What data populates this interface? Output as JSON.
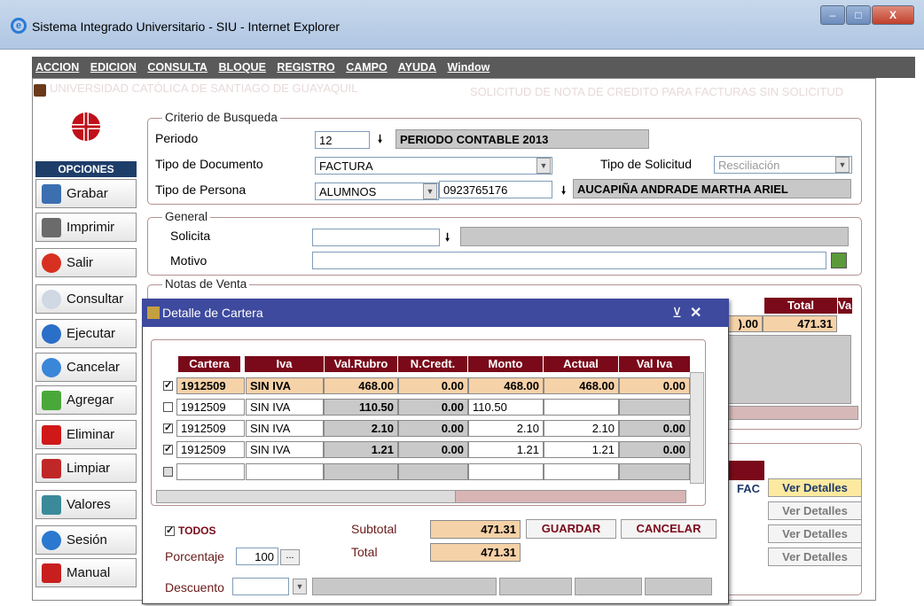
{
  "window": {
    "title": "Sistema Integrado Universitario - SIU - Internet Explorer",
    "btn_min": "–",
    "btn_max": "□",
    "btn_close": "X"
  },
  "menu": [
    "ACCION",
    "EDICION",
    "CONSULTA",
    "BLOQUE",
    "REGISTRO",
    "CAMPO",
    "AYUDA",
    "Window"
  ],
  "header": {
    "university": "UNIVERSIDAD CATÓLICA DE SANTIAGO DE GUAYAQUIL",
    "form_title": "SOLICITUD DE NOTA DE CREDITO PARA FACTURAS SIN SOLICITUD"
  },
  "sidebar": {
    "heading": "OPCIONES",
    "buttons": [
      {
        "label": "Grabar",
        "icon": "save-icon"
      },
      {
        "label": "Imprimir",
        "icon": "printer-icon"
      },
      {
        "label": "Salir",
        "icon": "power-icon"
      },
      {
        "label": "Consultar",
        "icon": "magnifier-icon"
      },
      {
        "label": "Ejecutar",
        "icon": "run-icon"
      },
      {
        "label": "Cancelar",
        "icon": "cancel-icon"
      },
      {
        "label": "Agregar",
        "icon": "plus-icon"
      },
      {
        "label": "Eliminar",
        "icon": "x-icon"
      },
      {
        "label": "Limpiar",
        "icon": "eraser-icon"
      },
      {
        "label": "Valores",
        "icon": "values-icon"
      },
      {
        "label": "Sesión",
        "icon": "user-icon"
      },
      {
        "label": "Manual",
        "icon": "pdf-icon"
      }
    ]
  },
  "criterio": {
    "legend": "Criterio de Busqueda",
    "periodo_label": "Periodo",
    "periodo_value": "12",
    "periodo_desc": "PERIODO CONTABLE 2013",
    "tipo_doc_label": "Tipo de Documento",
    "tipo_doc_value": "FACTURA",
    "tipo_sol_label": "Tipo de Solicitud",
    "tipo_sol_value": "Resciliación",
    "tipo_persona_label": "Tipo de Persona",
    "tipo_persona_value": "ALUMNOS",
    "persona_id": "0923765176",
    "persona_name": "AUCAPIÑA ANDRADE MARTHA ARIEL"
  },
  "general": {
    "legend": "General",
    "solicita_label": "Solicita",
    "motivo_label": "Motivo"
  },
  "notas": {
    "legend": "Notas de Venta",
    "col_total": "Total",
    "col_va": "Va",
    "row1_partial": ").00",
    "row1_total": "471.31",
    "col_fac": "FAC",
    "ver_detalles": "Ver Detalles"
  },
  "dialog": {
    "title": "Detalle de Cartera",
    "min": "⊻",
    "close": "✕",
    "columns": [
      "Cartera",
      "Iva",
      "Val.Rubro",
      "N.Credt.",
      "Monto",
      "Actual",
      "Val Iva"
    ],
    "rows": [
      {
        "checked": true,
        "cartera": "1912509",
        "iva": "SIN IVA",
        "val_rubro": "468.00",
        "ncredt": "0.00",
        "monto": "468.00",
        "actual": "468.00",
        "val_iva": "0.00"
      },
      {
        "checked": false,
        "cartera": "1912509",
        "iva": "SIN IVA",
        "val_rubro": "110.50",
        "ncredt": "0.00",
        "monto": "110.50",
        "actual": "",
        "val_iva": ""
      },
      {
        "checked": true,
        "cartera": "1912509",
        "iva": "SIN IVA",
        "val_rubro": "2.10",
        "ncredt": "0.00",
        "monto": "2.10",
        "actual": "2.10",
        "val_iva": "0.00"
      },
      {
        "checked": true,
        "cartera": "1912509",
        "iva": "SIN IVA",
        "val_rubro": "1.21",
        "ncredt": "0.00",
        "monto": "1.21",
        "actual": "1.21",
        "val_iva": "0.00"
      }
    ],
    "todos_label": "TODOS",
    "subtotal_label": "Subtotal",
    "subtotal_value": "471.31",
    "total_label": "Total",
    "total_value": "471.31",
    "guardar": "GUARDAR",
    "cancelar": "CANCELAR",
    "porcentaje_label": "Porcentaje",
    "porcentaje_value": "100",
    "ellipsis": "...",
    "descuento_label": "Descuento"
  }
}
